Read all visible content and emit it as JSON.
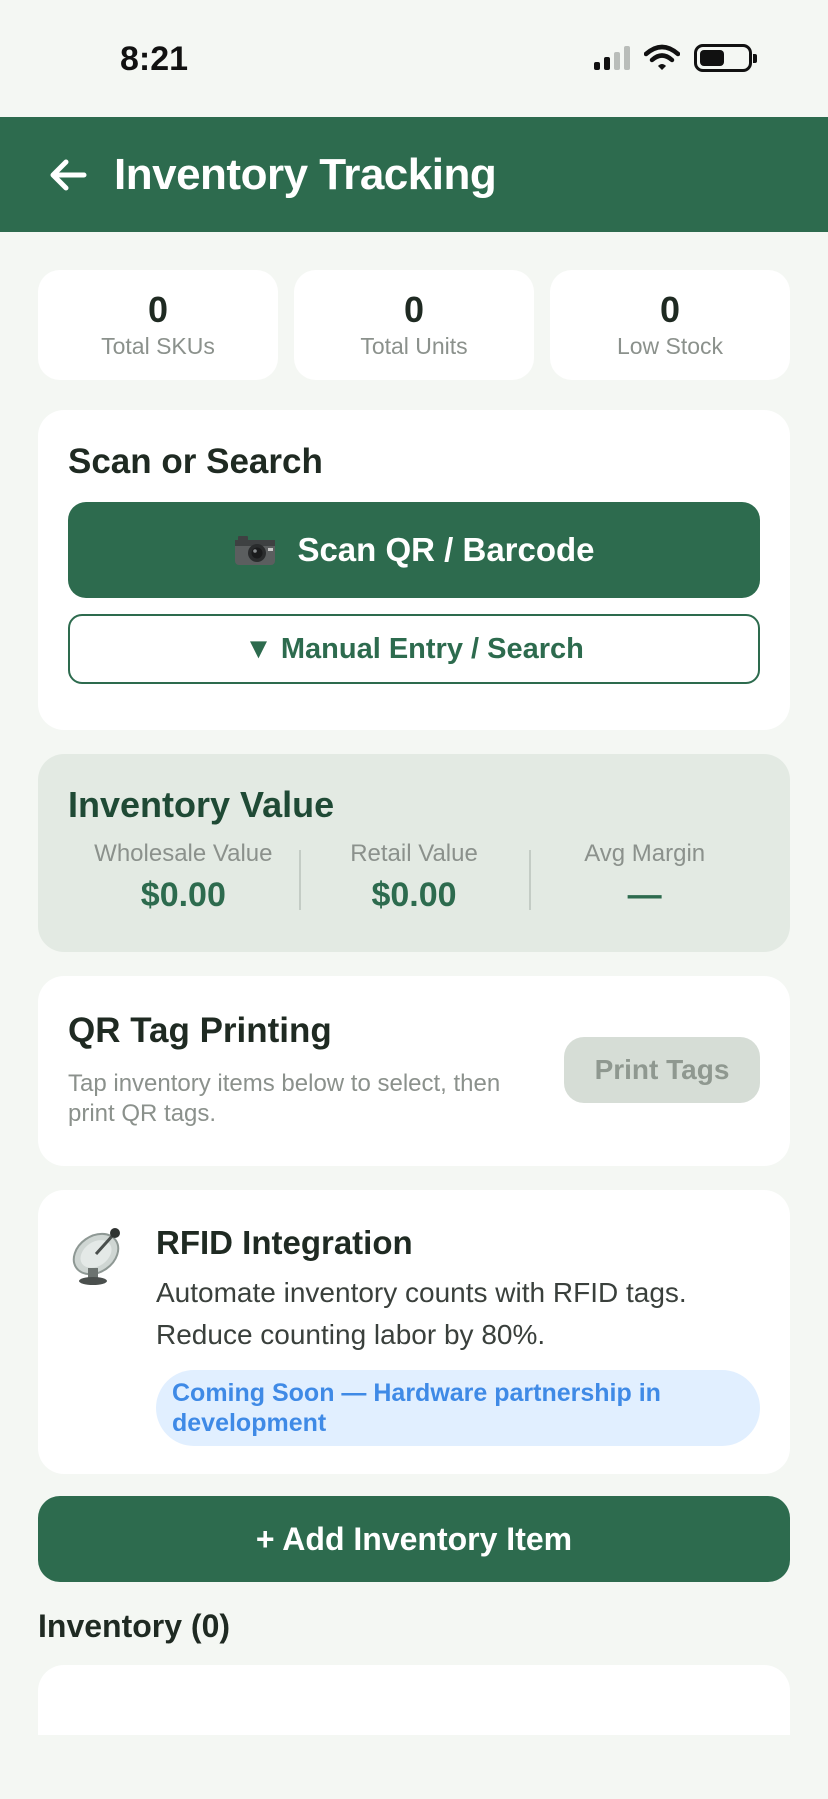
{
  "status_bar": {
    "time": "8:21"
  },
  "header": {
    "title": "Inventory Tracking"
  },
  "stats": [
    {
      "value": "0",
      "label": "Total SKUs"
    },
    {
      "value": "0",
      "label": "Total Units"
    },
    {
      "value": "0",
      "label": "Low Stock"
    }
  ],
  "scan": {
    "title": "Scan or Search",
    "scan_label": "Scan QR / Barcode",
    "manual_label": "▼ Manual Entry / Search"
  },
  "value": {
    "title": "Inventory Value",
    "columns": [
      {
        "label": "Wholesale Value",
        "amount": "$0.00"
      },
      {
        "label": "Retail Value",
        "amount": "$0.00"
      },
      {
        "label": "Avg Margin",
        "amount": "—"
      }
    ]
  },
  "qr": {
    "title": "QR Tag Printing",
    "description": "Tap inventory items below to select, then print QR tags.",
    "button_label": "Print Tags"
  },
  "rfid": {
    "title": "RFID Integration",
    "description": "Automate inventory counts with RFID tags. Reduce counting labor by 80%.",
    "badge": "Coming Soon — Hardware partnership in development"
  },
  "add_button_label": "+ Add Inventory Item",
  "inventory_heading": "Inventory (0)",
  "colors": {
    "primary": "#2d6b4e",
    "background": "#f4f7f3",
    "badge_text": "#3f8ae6"
  }
}
